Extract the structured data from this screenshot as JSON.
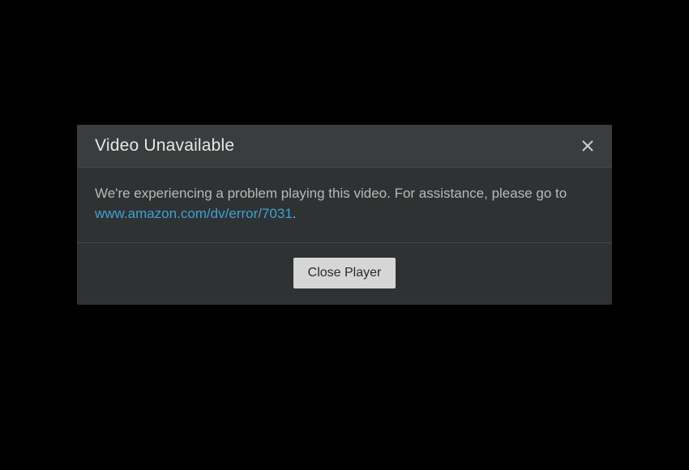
{
  "dialog": {
    "title": "Video Unavailable",
    "message_prefix": "We're experiencing a problem playing this video. For assistance, please go to ",
    "link_text": "www.amazon.com/dv/error/7031",
    "message_suffix": ".",
    "close_button_label": "Close Player"
  }
}
